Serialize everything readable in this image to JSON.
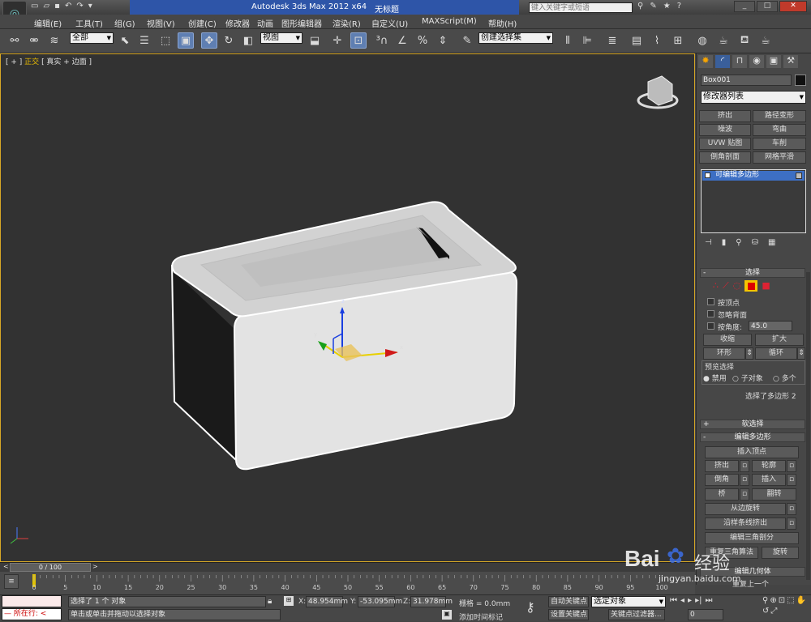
{
  "title_bar": {
    "app_title": "Autodesk 3ds Max  2012 x64",
    "file_name": "无标题",
    "search_placeholder": "键入关键字或短语"
  },
  "quick_access_labels": [
    "☰"
  ],
  "menu": [
    "编辑(E)",
    "工具(T)",
    "组(G)",
    "视图(V)",
    "创建(C)",
    "修改器",
    "动画",
    "图形编辑器",
    "渲染(R)",
    "自定义(U)",
    "MAXScript(M)",
    "帮助(H)"
  ],
  "toolbar": {
    "filter_value": "全部",
    "ref_coord_value": "视图",
    "named_selection_value": "创建选择集"
  },
  "viewport": {
    "label_plus": "[ + ]",
    "label_view": "正交",
    "label_shading": "[ 真实 + 边面 ]",
    "gizmo_z": "z",
    "gizmo_x": "x",
    "gizmo_y": "y"
  },
  "command_panel": {
    "object_name": "Box001",
    "modifier_list": "修改器列表",
    "modifier_buttons": [
      "挤出",
      "路径变形",
      "噪波",
      "弯曲",
      "UVW 贴图",
      "车削",
      "倒角剖面",
      "网格平滑"
    ],
    "stack_item": "可编辑多边形",
    "selection_rollout": "选择",
    "by_vertex": "按顶点",
    "ignore_backface": "忽略背面",
    "by_angle": "按角度:",
    "angle_value": "45.0",
    "shrink": "收缩",
    "grow": "扩大",
    "ring": "环形",
    "loop": "循环",
    "preview_selection": "预览选择",
    "preview_disable": "禁用",
    "preview_subobject": "子对象",
    "preview_multi": "多个",
    "selected_info": "选择了多边形 2",
    "soft_selection": "软选择",
    "edit_polygons": "编辑多边形",
    "insert_vertex": "插入顶点",
    "extrude": "挤出",
    "outline": "轮廓",
    "bevel": "倒角",
    "inset": "插入",
    "bridge": "桥",
    "flip": "翻转",
    "hinge_from_edge": "从边旋转",
    "extrude_along_spline": "沿样条线挤出",
    "edit_triangulation": "编辑三角剖分",
    "retriangulate": "重复三角算法",
    "turn": "旋转",
    "extra_1": "编辑几何体",
    "extra_2": "重复上一个"
  },
  "timeline": {
    "frame_counter": "0 / 100",
    "ticks": [
      "0",
      "5",
      "10",
      "15",
      "20",
      "25",
      "30",
      "35",
      "40",
      "45",
      "50",
      "55",
      "60",
      "65",
      "70",
      "75",
      "80",
      "85",
      "90",
      "95",
      "100"
    ]
  },
  "status": {
    "prompt_top": "选择了 1 个 对象",
    "prompt_bottom": "单击或单击并拖动以选择对象",
    "script_label": "所在行:",
    "x_label": "X:",
    "x_value": "48.954mm",
    "y_label": "Y:",
    "y_value": "-53.095mm",
    "z_label": "Z:",
    "z_value": "31.978mm",
    "grid": "栅格 = 0.0mm",
    "add_time_tag": "添加时间标记",
    "auto_key": "自动关键点",
    "set_key": "设置关键点",
    "selected_object": "选定对象",
    "key_filters": "关键点过滤器...",
    "frame_value": "0"
  },
  "watermark": {
    "brand": "Bai",
    "brand2": "经验",
    "url": "jingyan.baidu.com"
  },
  "colors": {
    "viewport_bg": "#323232",
    "viewport_border": "#d7a826",
    "stack_highlight": "#3d6fc4",
    "active_select": "#f5c400"
  }
}
